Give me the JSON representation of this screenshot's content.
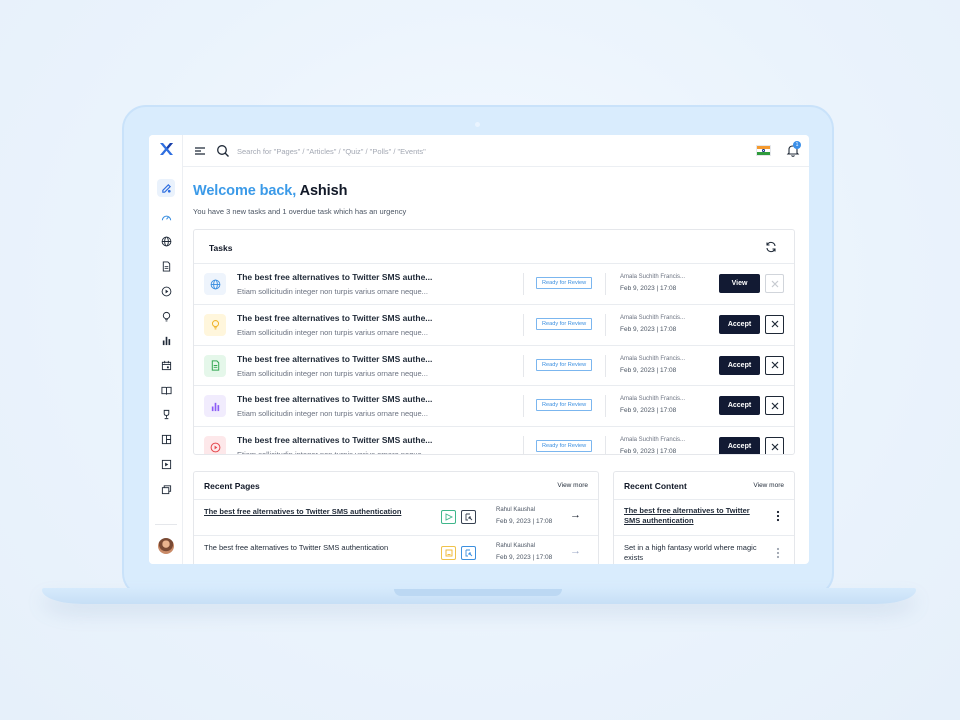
{
  "search": {
    "placeholder": "Search for \"Pages\" / \"Articles\" / \"Quiz\" / \"Polls\" / \"Events\""
  },
  "notifications": {
    "count": "1"
  },
  "welcome": {
    "greeting": "Welcome back,",
    "name": "Ashish"
  },
  "subtitle": "You have 3 new tasks and 1 overdue task which has an urgency",
  "tasks": {
    "title": "Tasks",
    "items": [
      {
        "icon": "globe-icon",
        "title": "The best free alternatives to Twitter SMS authe...",
        "desc": "Etiam sollicitudin integer non turpis varius ornare neque...",
        "status": "Ready for Review",
        "author": "Amala Suchith Francis...",
        "date": "Feb 9, 2023 | 17:08",
        "action": "View",
        "icon_bg": "#eef4fc",
        "icon_color": "#3b8fe0"
      },
      {
        "icon": "bulb-icon",
        "title": "The best free alternatives to Twitter SMS authe...",
        "desc": "Etiam sollicitudin integer non turpis varius ornare neque...",
        "status": "Ready for Review",
        "author": "Amala Suchith Francis...",
        "date": "Feb 9, 2023 | 17:08",
        "action": "Accept",
        "icon_bg": "#fff6dc",
        "icon_color": "#f0b429"
      },
      {
        "icon": "document-icon",
        "title": "The best free alternatives to Twitter SMS authe...",
        "desc": "Etiam sollicitudin integer non turpis varius ornare neque...",
        "status": "Ready for Review",
        "author": "Amala Suchith Francis...",
        "date": "Feb 9, 2023 | 17:08",
        "action": "Accept",
        "icon_bg": "#e5f7ea",
        "icon_color": "#34a853"
      },
      {
        "icon": "bar-chart-icon",
        "title": "The best free alternatives to Twitter SMS authe...",
        "desc": "Etiam sollicitudin integer non turpis varius ornare neque...",
        "status": "Ready for Review",
        "author": "Amala Suchith Francis...",
        "date": "Feb 9, 2023 | 17:08",
        "action": "Accept",
        "icon_bg": "#f1ecfd",
        "icon_color": "#8b5cf6"
      },
      {
        "icon": "play-icon",
        "title": "The best free alternatives to Twitter SMS authe...",
        "desc": "Etiam sollicitudin integer non turpis varius ornare neque...",
        "status": "Ready for Review",
        "author": "Amala Suchith Francis...",
        "date": "Feb 9, 2023 | 17:08",
        "action": "Accept",
        "icon_bg": "#fde8ea",
        "icon_color": "#e5484d"
      }
    ]
  },
  "recent_pages": {
    "title": "Recent Pages",
    "view_more": "View more",
    "items": [
      {
        "title": "The best free alternatives to Twitter SMS authentication",
        "author": "Rahul Kaushal",
        "date": "Feb 9, 2023 | 17:08",
        "arrow": "→"
      },
      {
        "title": "The best free alternatives to Twitter SMS authentication",
        "author": "Rahul Kaushal",
        "date": "Feb 9, 2023 | 17:08",
        "arrow": "→"
      }
    ]
  },
  "recent_content": {
    "title": "Recent Content",
    "view_more": "View more",
    "items": [
      {
        "title": "The best free alternatives to Twitter SMS authentication"
      },
      {
        "title": "Set in a high fantasy world where magic exists"
      }
    ]
  },
  "colors": {
    "accent": "#3b9ae8",
    "primary_button": "#121a33",
    "badge": "#7bb6ef",
    "laptop": "#d9ecfd"
  }
}
